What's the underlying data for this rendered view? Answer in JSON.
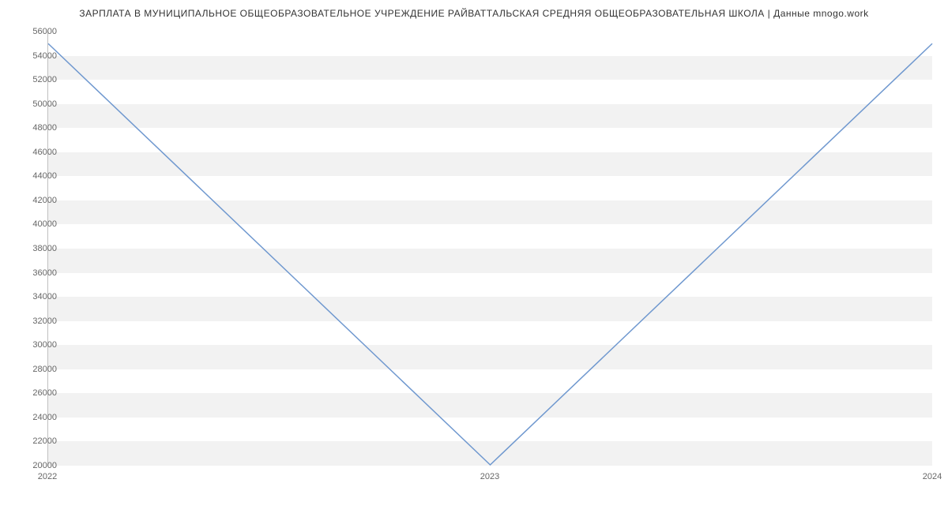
{
  "chart_data": {
    "type": "line",
    "title": "ЗАРПЛАТА В МУНИЦИПАЛЬНОЕ ОБЩЕОБРАЗОВАТЕЛЬНОЕ УЧРЕЖДЕНИЕ РАЙВАТТАЛЬСКАЯ СРЕДНЯЯ ОБЩЕОБРАЗОВАТЕЛЬНАЯ ШКОЛА  | Данные mnogo.work",
    "x": [
      2022,
      2023,
      2024
    ],
    "series": [
      {
        "name": "salary",
        "values": [
          55000,
          20000,
          55000
        ],
        "color": "#6f98cf"
      }
    ],
    "xlabel": "",
    "ylabel": "",
    "ylim": [
      20000,
      56000
    ],
    "y_ticks": [
      20000,
      22000,
      24000,
      26000,
      28000,
      30000,
      32000,
      34000,
      36000,
      38000,
      40000,
      42000,
      44000,
      46000,
      48000,
      50000,
      52000,
      54000,
      56000
    ],
    "x_ticks": [
      2022,
      2023,
      2024
    ],
    "grid": true,
    "band_color": "#f2f2f2"
  }
}
